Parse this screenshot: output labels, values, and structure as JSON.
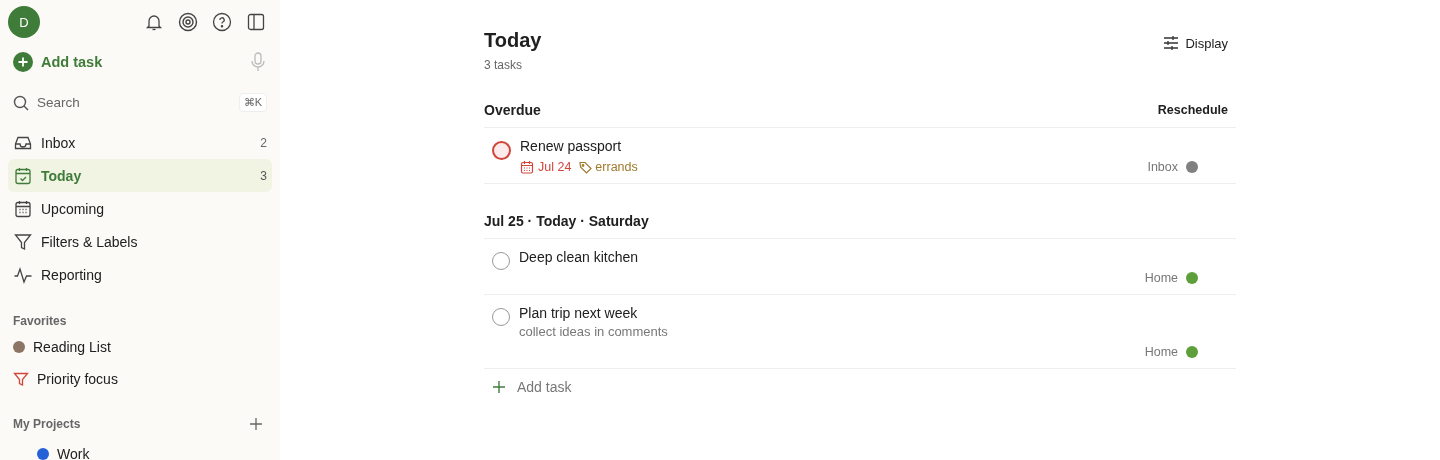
{
  "sidebar": {
    "avatar": "D",
    "add_task": "Add task",
    "search": {
      "placeholder": "Search",
      "shortcut": "⌘K"
    },
    "nav": [
      {
        "kind": "inbox",
        "label": "Inbox",
        "count": "2",
        "selected": false
      },
      {
        "kind": "today",
        "label": "Today",
        "count": "3",
        "selected": true
      },
      {
        "kind": "upcoming",
        "label": "Upcoming",
        "selected": false
      },
      {
        "kind": "filters",
        "label": "Filters & Labels",
        "selected": false
      },
      {
        "kind": "reporting",
        "label": "Reporting",
        "selected": false
      }
    ],
    "favorites": {
      "title": "Favorites",
      "items": [
        {
          "kind": "project",
          "label": "Reading List",
          "color": "#8d7566"
        },
        {
          "kind": "filter",
          "label": "Priority focus",
          "color": "#d1453b"
        }
      ]
    },
    "projects": {
      "title": "My Projects",
      "items": [
        {
          "label": "Work",
          "color": "#2461d8"
        }
      ]
    }
  },
  "main": {
    "title": "Today",
    "subtitle": "3 tasks",
    "display_button": "Display",
    "sections": [
      {
        "title": "Overdue",
        "action": "Reschedule",
        "tasks": [
          {
            "title": "Renew passport",
            "high_priority": true,
            "date": "Jul 24",
            "label": "errands",
            "project": "Inbox",
            "color": "#808080"
          }
        ]
      },
      {
        "title": "Jul 25 · Today · Saturday",
        "tasks": [
          {
            "title": "Deep clean kitchen",
            "high_priority": false,
            "project": "Home",
            "color": "#5e9f3c"
          },
          {
            "title": "Plan trip next week",
            "high_priority": false,
            "description": "collect ideas in comments",
            "project": "Home",
            "color": "#5e9f3c"
          }
        ]
      }
    ],
    "add_task": "Add task"
  }
}
